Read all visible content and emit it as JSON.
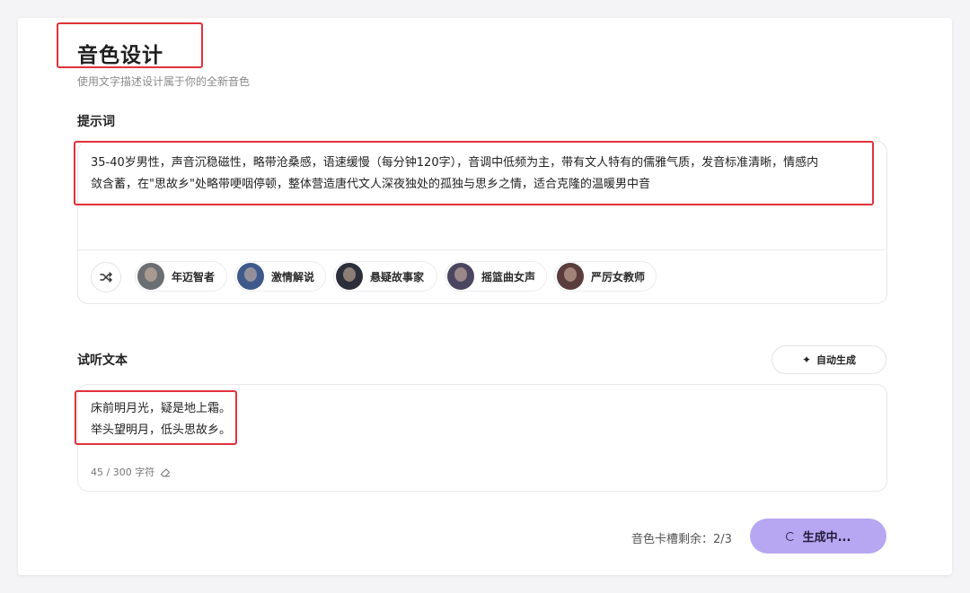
{
  "header": {
    "title": "音色设计",
    "subtitle": "使用文字描述设计属于你的全新音色"
  },
  "prompt": {
    "label": "提示词",
    "text_line1": "35-40岁男性，声音沉稳磁性，略带沧桑感，语速缓慢（每分钟120字），音调中低频为主，带有文人特有的儒雅气质，发音标准清晰，情感内",
    "text_line2": "敛含蓄，在\"思故乡\"处略带哽咽停顿，整体营造唐代文人深夜独处的孤独与思乡之情，适合克隆的温暖男中音",
    "shuffle_icon": "shuffle-icon",
    "presets": [
      {
        "label": "年迈智者",
        "avatar_color": "#6b6f73"
      },
      {
        "label": "激情解说",
        "avatar_color": "#3d5a8a"
      },
      {
        "label": "悬疑故事家",
        "avatar_color": "#2c2f3a"
      },
      {
        "label": "摇篮曲女声",
        "avatar_color": "#4a4660"
      },
      {
        "label": "严厉女教师",
        "avatar_color": "#5a3c3c"
      }
    ]
  },
  "listen": {
    "label": "试听文本",
    "auto_label": "自动生成",
    "line1": "床前明月光，疑是地上霜。",
    "line2": "举头望明月，低头思故乡。",
    "char_count": "45 / 300 字符"
  },
  "footer": {
    "slot_text": "音色卡槽剩余：2/3",
    "generate_label": "生成中..."
  },
  "colors": {
    "highlight": "#e0313b",
    "generate_button": "#b7a7f2"
  }
}
